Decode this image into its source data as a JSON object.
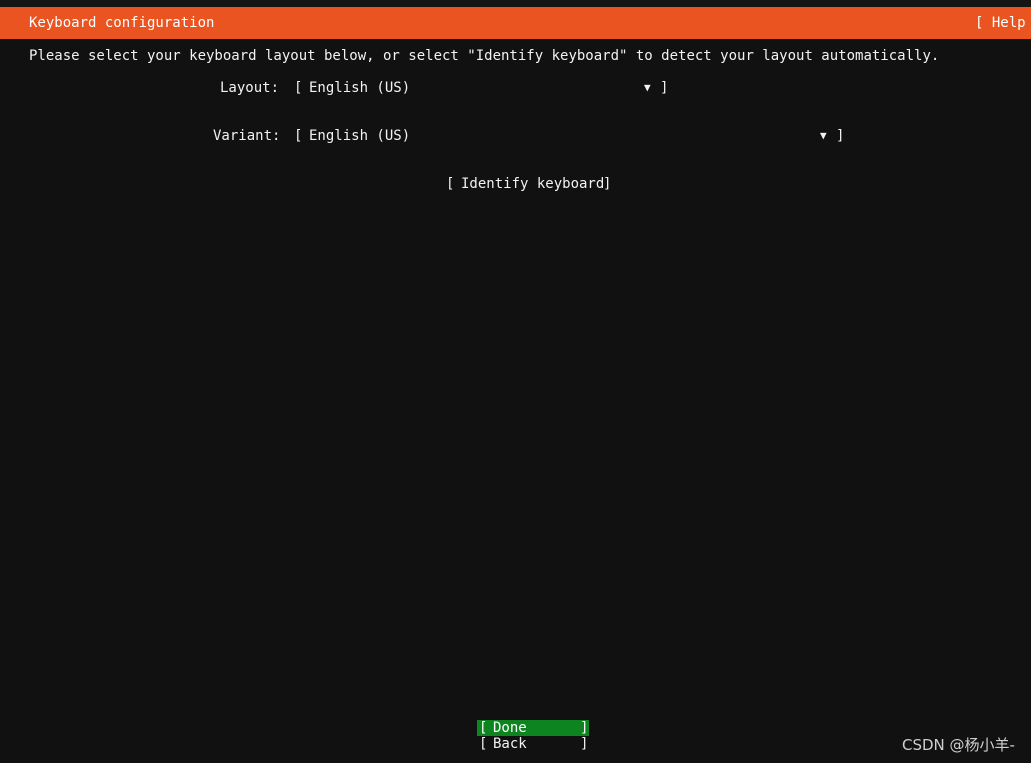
{
  "header": {
    "title": "Keyboard configuration",
    "help_label": "[ Help ]",
    "color": "#e95420"
  },
  "instructions": "Please select your keyboard layout below, or select \"Identify keyboard\" to detect your layout automatically.",
  "layout_field": {
    "label": "Layout:",
    "value": "English (US)",
    "open_bracket": "[",
    "close_bracket": "]",
    "arrow_icon": "triangle-down-icon",
    "arrow": "▼"
  },
  "variant_field": {
    "label": "Variant:",
    "value": "English (US)",
    "open_bracket": "[",
    "close_bracket": "]",
    "arrow_icon": "triangle-down-icon",
    "arrow": "▼"
  },
  "identify_button": {
    "open_bracket": "[",
    "label": "Identify keyboard",
    "close_bracket": "]"
  },
  "buttons": {
    "done": {
      "open_bracket": "[",
      "label": "Done",
      "close_bracket": "]",
      "focused": true,
      "focus_color": "#0e8420"
    },
    "back": {
      "open_bracket": "[",
      "label": "Back",
      "close_bracket": "]",
      "focused": false
    }
  },
  "watermark": "CSDN @杨小羊-",
  "colors": {
    "background": "#111111",
    "text": "#f2f2f2",
    "accent": "#e95420"
  }
}
